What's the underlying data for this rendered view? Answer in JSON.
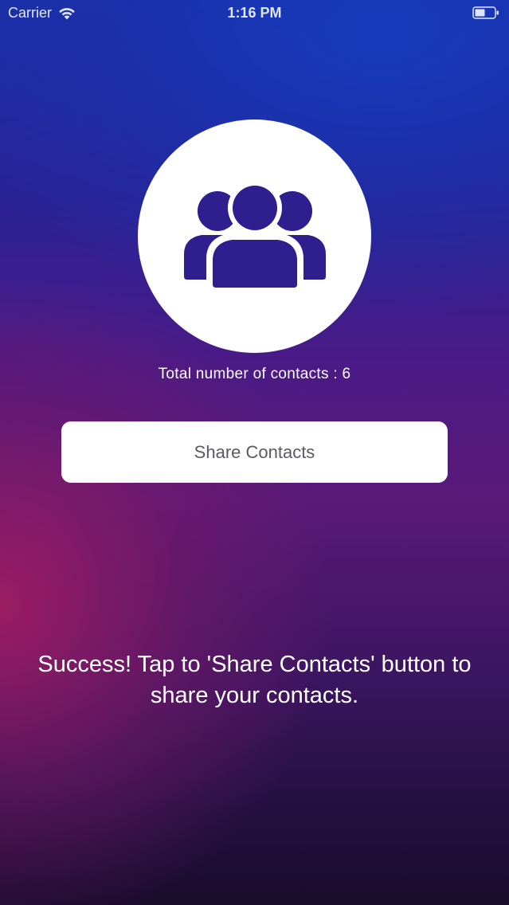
{
  "status_bar": {
    "carrier": "Carrier",
    "time": "1:16 PM",
    "wifi_icon": "wifi-icon",
    "battery_icon": "battery-icon"
  },
  "avatar": {
    "icon": "contacts-group-icon",
    "icon_color": "#2e1e8e"
  },
  "contacts": {
    "count_label": "Total number of contacts : 6"
  },
  "share_button": {
    "label": "Share Contacts"
  },
  "message": {
    "text": "Success! Tap to 'Share Contacts' button to share your contacts."
  },
  "colors": {
    "background_top": "#1a2fa8",
    "background_magenta": "#a01c62",
    "background_bottom": "#1a0c2c",
    "button_text": "#5a5a66"
  }
}
